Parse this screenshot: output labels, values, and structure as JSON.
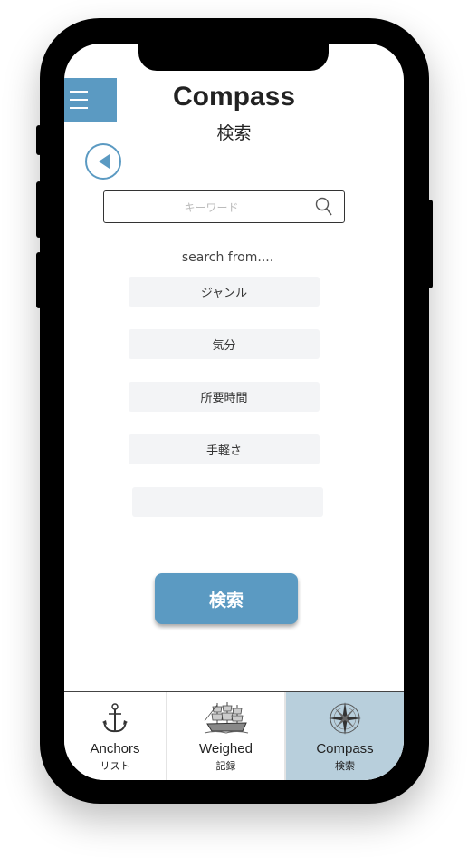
{
  "header": {
    "title": "Compass",
    "subtitle": "検索"
  },
  "search": {
    "placeholder": "キーワード"
  },
  "filters": {
    "heading": "search from....",
    "options": [
      "ジャンル",
      "気分",
      "所要時間",
      "手軽さ",
      ""
    ]
  },
  "submit": {
    "label": "検索"
  },
  "tabbar": {
    "tabs": [
      {
        "label": "Anchors",
        "sub": "リスト",
        "icon": "anchor-icon"
      },
      {
        "label": "Weighed",
        "sub": "記録",
        "icon": "ship-icon"
      },
      {
        "label": "Compass",
        "sub": "検索",
        "icon": "compass-rose-icon",
        "active": true
      }
    ]
  },
  "colors": {
    "accent": "#5b9ac2",
    "active_tab": "#b8cfdc",
    "filter_bg": "#f3f4f6"
  }
}
